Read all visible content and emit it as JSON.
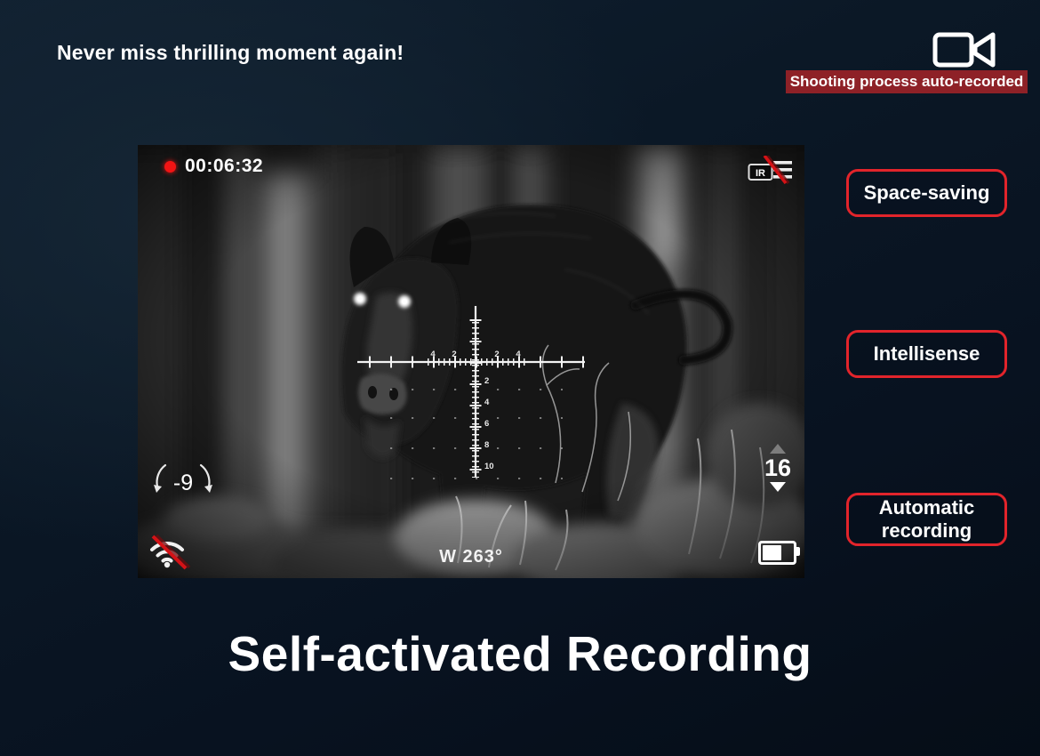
{
  "header": {
    "tagline": "Never miss thrilling moment again!",
    "badge_label": "Shooting process auto-recorded"
  },
  "features": {
    "items": [
      {
        "label": "Space-saving"
      },
      {
        "label": "Intellisense"
      },
      {
        "label": "Automatic recording"
      }
    ]
  },
  "viewfinder": {
    "recording_time": "00:06:32",
    "ir_label": "IR",
    "tilt": "-9",
    "zoom": "16",
    "heading": "W 263°",
    "reticle": {
      "h_numbers": [
        "4",
        "2",
        "2",
        "4"
      ],
      "v_numbers": [
        "2",
        "4",
        "6",
        "8",
        "10"
      ]
    }
  },
  "footer": {
    "title": "Self-activated Recording"
  },
  "colors": {
    "accent_red": "#e2242b",
    "banner_red": "#8e2127",
    "record_red": "#f21414",
    "background_navy": "#0b1826"
  },
  "icons": {
    "top_right": "video-camera-icon",
    "status_left": "record-dot-icon",
    "status_right": "ir-off-icon",
    "bottom_left": "wifi-off-icon",
    "bottom_right": "battery-icon",
    "tilt": "tilt-arc-arrows-icon",
    "zoom_up": "triangle-up-icon",
    "zoom_down": "triangle-down-icon"
  }
}
